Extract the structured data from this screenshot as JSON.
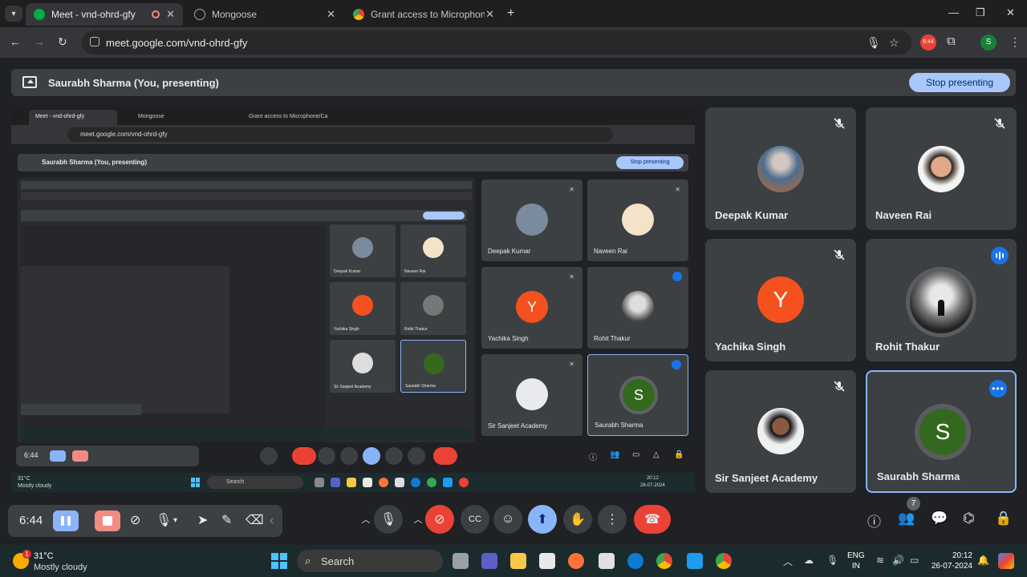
{
  "browser": {
    "tabs": [
      {
        "label": "Meet - vnd-ohrd-gfy",
        "active": true
      },
      {
        "label": "Mongoose",
        "active": false
      },
      {
        "label": "Grant access to Microphone/Ca",
        "active": false
      }
    ],
    "url": "meet.google.com/vnd-ohrd-gfy",
    "badge_time": "6:44",
    "profile_initial": "S"
  },
  "meet": {
    "banner_title": "Saurabh Sharma (You, presenting)",
    "stop_presenting_label": "Stop presenting",
    "participants": [
      {
        "name": "Deepak Kumar",
        "muted": true
      },
      {
        "name": "Naveen Rai",
        "muted": true
      },
      {
        "name": "Yachika Singh",
        "initial": "Y",
        "muted": true
      },
      {
        "name": "Rohit Thakur",
        "muted": false,
        "speaking": true
      },
      {
        "name": "Sir Sanjeet Academy",
        "muted": true
      },
      {
        "name": "Saurabh Sharma",
        "initial": "S",
        "selected": true
      }
    ],
    "people_count": "7"
  },
  "presenter_bar": {
    "time": "6:44"
  },
  "taskbar": {
    "temperature": "31°C",
    "condition": "Mostly cloudy",
    "weather_badge": "1",
    "search_placeholder": "Search",
    "lang_line1": "ENG",
    "lang_line2": "IN",
    "time": "20:12",
    "date": "26-07-2024"
  },
  "colors": {
    "accent_blue": "#8ab4f8",
    "leave_red": "#ea4335",
    "tile_bg": "#3c4043",
    "yachika_avatar": "#f4511e",
    "saurabh_avatar": "#33691e"
  }
}
